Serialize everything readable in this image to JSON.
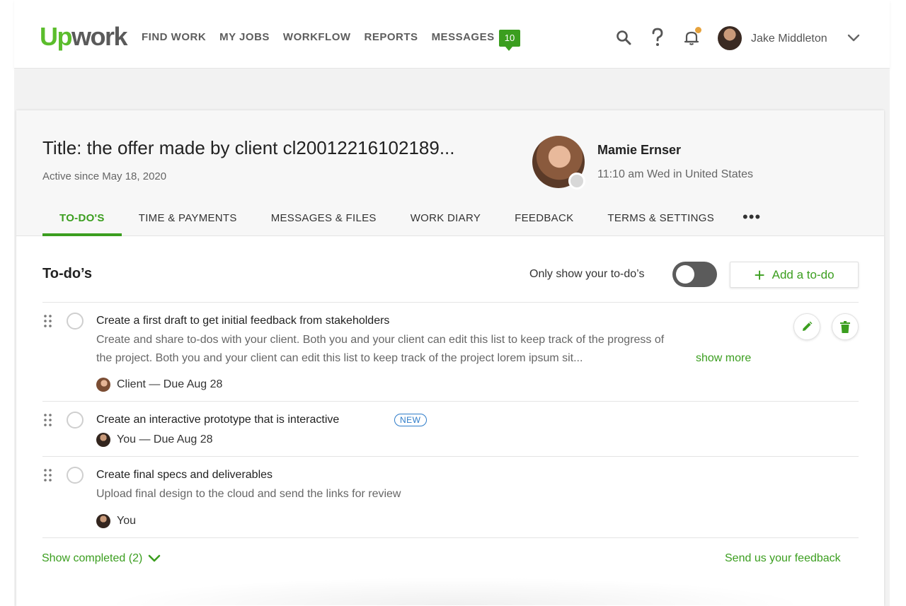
{
  "nav": {
    "logo_up": "Up",
    "logo_work": "work",
    "links": [
      "FIND WORK",
      "MY JOBS",
      "WORKFLOW",
      "REPORTS",
      "MESSAGES"
    ],
    "messages_count": "10",
    "username": "Jake Middleton",
    "icons": [
      "search-icon",
      "help-icon",
      "bell-icon",
      "chevron-down-icon"
    ]
  },
  "contract": {
    "title": "Title: the offer made by client cl20012216102189...",
    "active_since": "Active since May 18, 2020",
    "client_name": "Mamie Ernser",
    "client_time": "11:10 am Wed in United States",
    "client_status": "offline"
  },
  "tabs": [
    {
      "label": "TO-DO'S",
      "active": true
    },
    {
      "label": "TIME & PAYMENTS",
      "active": false
    },
    {
      "label": "MESSAGES & FILES",
      "active": false
    },
    {
      "label": "WORK DIARY",
      "active": false
    },
    {
      "label": "FEEDBACK",
      "active": false
    },
    {
      "label": "TERMS & SETTINGS",
      "active": false
    }
  ],
  "tab_more": "•••",
  "todos_section": {
    "title": "To-do’s",
    "toggle_label": "Only show your to-do’s",
    "toggle_on": false,
    "add_button": "Add a to-do"
  },
  "todos": [
    {
      "title": "Create a first draft to get initial feedback from stakeholders",
      "desc_line1": "Create and share to-dos with your client. Both you and your client can edit this list to keep track of the progress of",
      "desc_line2": "the project. Both you and your client can edit this list to keep track of the project lorem ipsum sit...",
      "show_more": "show more",
      "assignee": "Client — Due Aug 28",
      "badge": ""
    },
    {
      "title": "Create an interactive prototype that is interactive",
      "assignee": "You — Due Aug 28",
      "badge": "NEW"
    },
    {
      "title": "Create final specs and deliverables",
      "desc_line1": "Upload final design to the cloud and send the links for review",
      "assignee": "You",
      "badge": ""
    }
  ],
  "footer": {
    "show_completed": "Show completed (2)",
    "feedback": "Send us your feedback"
  },
  "colors": {
    "brand_green": "#3b9e1f",
    "badge_blue": "#2e7cc9",
    "notification_dot": "#e6a23c"
  }
}
